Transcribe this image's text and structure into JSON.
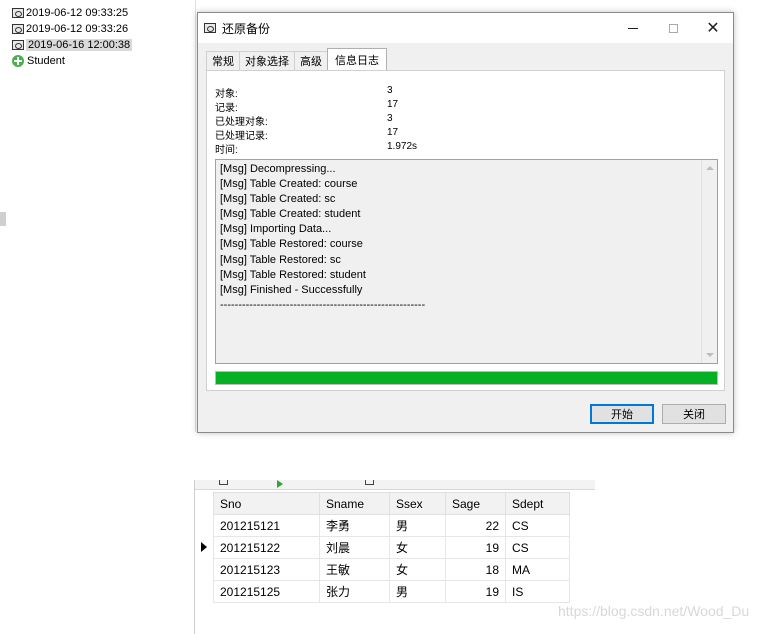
{
  "tree": {
    "items": [
      {
        "label": "2019-06-12 09:33:25",
        "icon": "backup-icon",
        "selected": false
      },
      {
        "label": "2019-06-12 09:33:26",
        "icon": "backup-icon",
        "selected": false
      },
      {
        "label": "2019-06-16 12:00:38",
        "icon": "backup-icon",
        "selected": true
      },
      {
        "label": "Student",
        "icon": "database-icon",
        "selected": false
      }
    ]
  },
  "dialog": {
    "title": "还原备份",
    "window_buttons": {
      "minimize": "—",
      "maximize": "☐",
      "close": "✕"
    },
    "tabs": [
      {
        "label": "常规",
        "active": false
      },
      {
        "label": "对象选择",
        "active": false
      },
      {
        "label": "高级",
        "active": false
      },
      {
        "label": "信息日志",
        "active": true
      }
    ],
    "stats": [
      {
        "label": "对象:",
        "value": "3"
      },
      {
        "label": "记录:",
        "value": "17"
      },
      {
        "label": "已处理对象:",
        "value": "3"
      },
      {
        "label": "已处理记录:",
        "value": "17"
      },
      {
        "label": "时间:",
        "value": "1.972s"
      }
    ],
    "log": [
      "[Msg] Decompressing...",
      "[Msg] Table Created: course",
      "[Msg] Table Created: sc",
      "[Msg] Table Created: student",
      "[Msg] Importing Data...",
      "[Msg] Table Restored: course",
      "[Msg] Table Restored: sc",
      "[Msg] Table Restored: student",
      "[Msg] Finished - Successfully",
      "--------------------------------------------------------"
    ],
    "progress_percent": 100,
    "progress_color": "#06b025",
    "buttons": {
      "start": "开始",
      "close": "关闭"
    }
  },
  "grid": {
    "columns": [
      "Sno",
      "Sname",
      "Ssex",
      "Sage",
      "Sdept"
    ],
    "current_row": 1,
    "rows": [
      [
        "201215121",
        "李勇",
        "男",
        "22",
        "CS"
      ],
      [
        "201215122",
        "刘晨",
        "女",
        "19",
        "CS"
      ],
      [
        "201215123",
        "王敏",
        "女",
        "18",
        "MA"
      ],
      [
        "201215125",
        "张力",
        "男",
        "19",
        "IS"
      ]
    ]
  },
  "watermark": "https://blog.csdn.net/Wood_Du"
}
